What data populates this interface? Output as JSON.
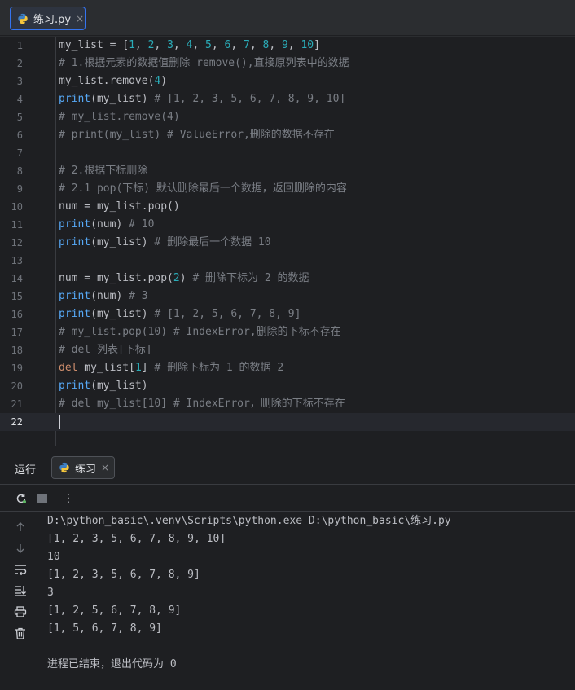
{
  "editor_tab": {
    "title": "练习.py",
    "close": "×"
  },
  "editor": {
    "lines": [
      {
        "n": "1",
        "parts": [
          [
            "t",
            "my_list = ["
          ],
          [
            "n",
            "1"
          ],
          [
            "t",
            ", "
          ],
          [
            "n",
            "2"
          ],
          [
            "t",
            ", "
          ],
          [
            "n",
            "3"
          ],
          [
            "t",
            ", "
          ],
          [
            "n",
            "4"
          ],
          [
            "t",
            ", "
          ],
          [
            "n",
            "5"
          ],
          [
            "t",
            ", "
          ],
          [
            "n",
            "6"
          ],
          [
            "t",
            ", "
          ],
          [
            "n",
            "7"
          ],
          [
            "t",
            ", "
          ],
          [
            "n",
            "8"
          ],
          [
            "t",
            ", "
          ],
          [
            "n",
            "9"
          ],
          [
            "t",
            ", "
          ],
          [
            "n",
            "10"
          ],
          [
            "t",
            "]"
          ]
        ]
      },
      {
        "n": "2",
        "parts": [
          [
            "c",
            "# 1.根据元素的数据值删除 remove(),直接原列表中的数据"
          ]
        ]
      },
      {
        "n": "3",
        "parts": [
          [
            "t",
            "my_list.remove("
          ],
          [
            "n",
            "4"
          ],
          [
            "t",
            ")"
          ]
        ]
      },
      {
        "n": "4",
        "parts": [
          [
            "f",
            "print"
          ],
          [
            "t",
            "(my_list) "
          ],
          [
            "c",
            "# [1, 2, 3, 5, 6, 7, 8, 9, 10]"
          ]
        ]
      },
      {
        "n": "5",
        "parts": [
          [
            "c",
            "# my_list.remove(4)"
          ]
        ]
      },
      {
        "n": "6",
        "parts": [
          [
            "c",
            "# print(my_list) # ValueError,删除的数据不存在"
          ]
        ]
      },
      {
        "n": "7",
        "parts": []
      },
      {
        "n": "8",
        "parts": [
          [
            "c",
            "# 2.根据下标删除"
          ]
        ]
      },
      {
        "n": "9",
        "parts": [
          [
            "c",
            "# 2.1 pop(下标) 默认删除最后一个数据，返回删除的内容"
          ]
        ]
      },
      {
        "n": "10",
        "parts": [
          [
            "t",
            "num = my_list.pop()"
          ]
        ]
      },
      {
        "n": "11",
        "parts": [
          [
            "f",
            "print"
          ],
          [
            "t",
            "(num) "
          ],
          [
            "c",
            "# 10"
          ]
        ]
      },
      {
        "n": "12",
        "parts": [
          [
            "f",
            "print"
          ],
          [
            "t",
            "(my_list) "
          ],
          [
            "c",
            "# 删除最后一个数据 10"
          ]
        ]
      },
      {
        "n": "13",
        "parts": []
      },
      {
        "n": "14",
        "parts": [
          [
            "t",
            "num = my_list.pop("
          ],
          [
            "n",
            "2"
          ],
          [
            "t",
            ") "
          ],
          [
            "c",
            "# 删除下标为 2 的数据"
          ]
        ]
      },
      {
        "n": "15",
        "parts": [
          [
            "f",
            "print"
          ],
          [
            "t",
            "(num) "
          ],
          [
            "c",
            "# 3"
          ]
        ]
      },
      {
        "n": "16",
        "parts": [
          [
            "f",
            "print"
          ],
          [
            "t",
            "(my_list) "
          ],
          [
            "c",
            "# [1, 2, 5, 6, 7, 8, 9]"
          ]
        ]
      },
      {
        "n": "17",
        "parts": [
          [
            "c",
            "# my_list.pop(10) # IndexError,删除的下标不存在"
          ]
        ]
      },
      {
        "n": "18",
        "parts": [
          [
            "c",
            "# del 列表[下标]"
          ]
        ]
      },
      {
        "n": "19",
        "parts": [
          [
            "k",
            "del"
          ],
          [
            "t",
            " my_list["
          ],
          [
            "n",
            "1"
          ],
          [
            "t",
            "] "
          ],
          [
            "c",
            "# 删除下标为 1 的数据 2"
          ]
        ]
      },
      {
        "n": "20",
        "parts": [
          [
            "f",
            "print"
          ],
          [
            "t",
            "(my_list)"
          ]
        ]
      },
      {
        "n": "21",
        "parts": [
          [
            "c",
            "# del my_list[10] # IndexError，删除的下标不存在"
          ]
        ]
      },
      {
        "n": "22",
        "parts": []
      }
    ],
    "current_line": "22"
  },
  "run_panel": {
    "label": "运行",
    "tab_title": "练习",
    "tab_close": "×",
    "toolbar": {
      "more_label": "⋮"
    },
    "console_lines": [
      "D:\\python_basic\\.venv\\Scripts\\python.exe D:\\python_basic\\练习.py",
      "[1, 2, 3, 5, 6, 7, 8, 9, 10]",
      "10",
      "[1, 2, 3, 5, 6, 7, 8, 9]",
      "3",
      "[1, 2, 5, 6, 7, 8, 9]",
      "[1, 5, 6, 7, 8, 9]",
      "",
      "进程已结束，退出代码为 0"
    ]
  },
  "colors": {
    "comment": "#7a7e85",
    "number": "#2aacb8",
    "function": "#56a8f5",
    "keyword": "#cf8e6d",
    "accent": "#3574f0"
  }
}
